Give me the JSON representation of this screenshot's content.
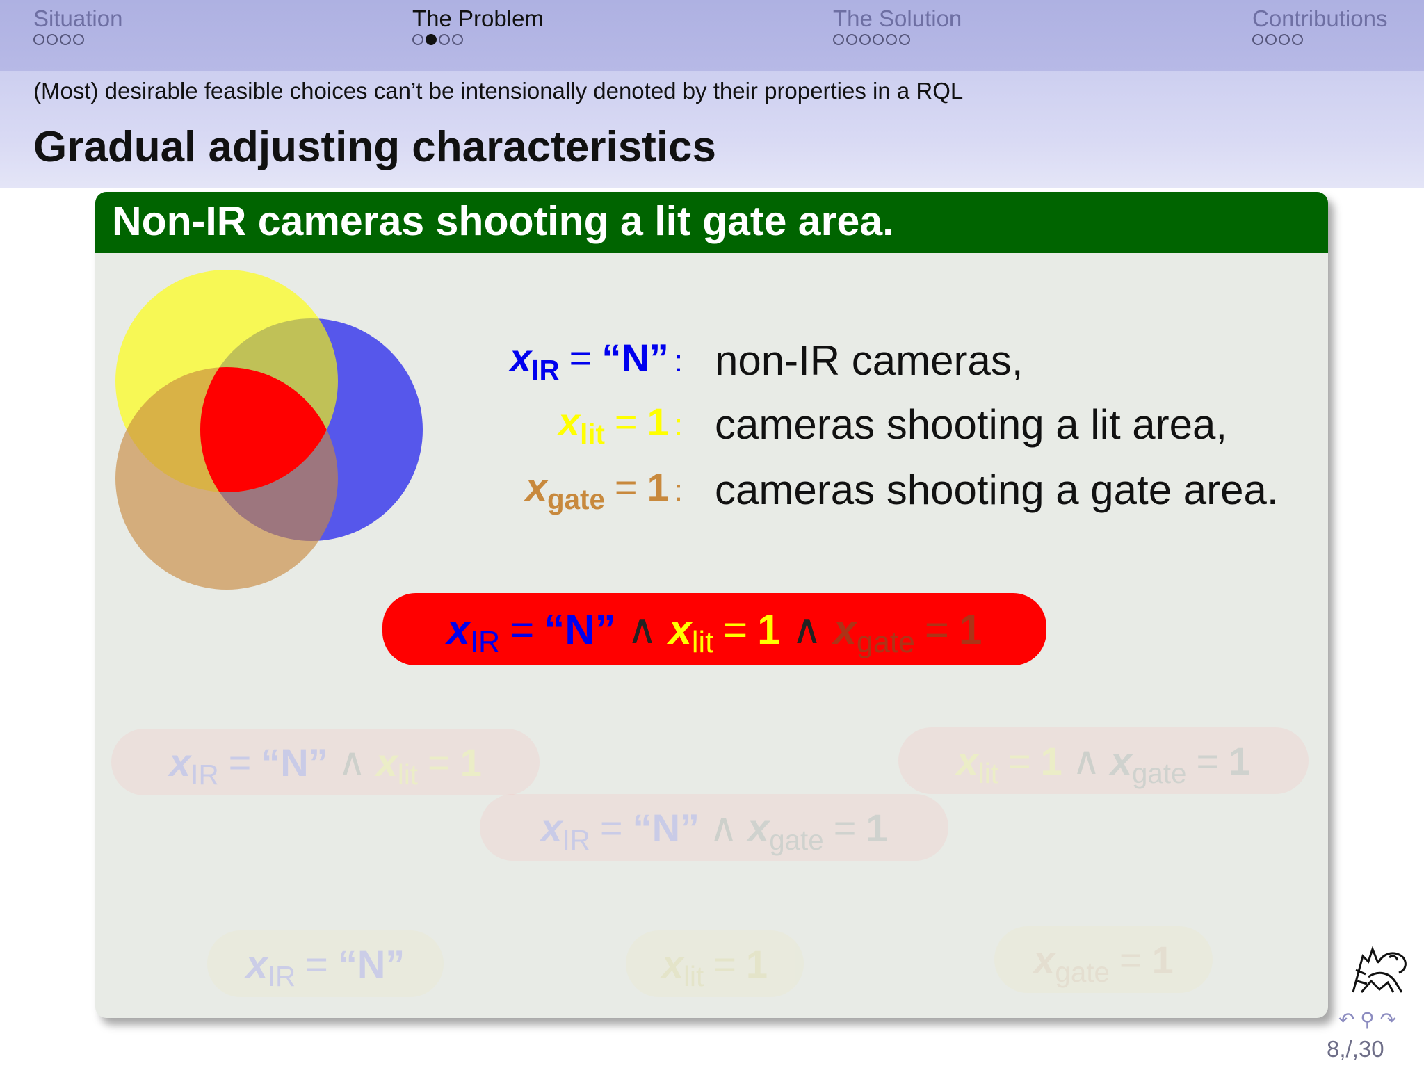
{
  "nav": {
    "sections": [
      {
        "title": "Situation",
        "dots": 4,
        "current": -1
      },
      {
        "title": "The Problem",
        "dots": 4,
        "current": 1
      },
      {
        "title": "The Solution",
        "dots": 6,
        "current": -1
      },
      {
        "title": "Contributions",
        "dots": 4,
        "current": -1
      }
    ]
  },
  "subsection": "(Most) desirable feasible choices can’t be intensionally denoted by their properties in a RQL",
  "frame_title": "Gradual adjusting characteristics",
  "block": {
    "title": "Non-IR cameras shooting a lit gate area.",
    "legend": [
      {
        "var": "x",
        "sub": "IR",
        "eq": "=",
        "value": "“N”",
        "colon": ":",
        "desc": "non-IR cameras,"
      },
      {
        "var": "x",
        "sub": "lit",
        "eq": "=",
        "value": "1",
        "colon": ":",
        "desc": "cameras shooting a lit area,"
      },
      {
        "var": "x",
        "sub": "gate",
        "eq": "=",
        "value": "1",
        "colon": ":",
        "desc": "cameras shooting a gate area."
      }
    ],
    "conj": {
      "x": "x",
      "ir": "IR",
      "eq": "=",
      "n": "“N”",
      "and": "∧",
      "lit": "lit",
      "gate": "gate",
      "one": "1"
    }
  },
  "colors": {
    "ir": "#0000ee",
    "lit": "#ffff00",
    "gate": "#c8893d",
    "block_header": "#006400",
    "block_body": "#e8ebe6",
    "highlight": "#ff0000"
  },
  "footer": {
    "nav_symbols": "↶ ⚲ ↷",
    "page_number": "8,/,30"
  }
}
